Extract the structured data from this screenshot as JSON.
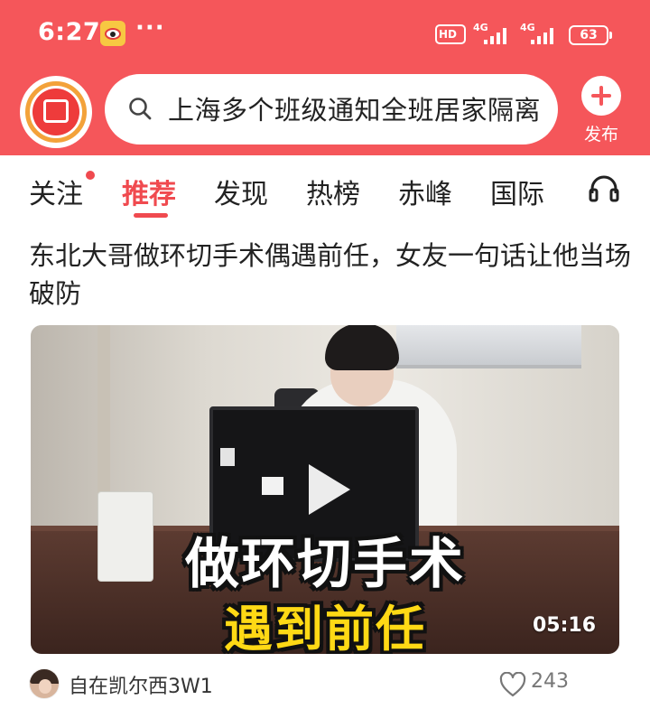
{
  "status_bar": {
    "time": "6:27",
    "more": "···",
    "hd_label": "HD",
    "signal1_label": "4G",
    "signal2_label": "4G",
    "battery": "63"
  },
  "header": {
    "search_query": "上海多个班级通知全班居家隔离",
    "post_label": "发布"
  },
  "tabs": [
    {
      "label": "关注"
    },
    {
      "label": "推荐"
    },
    {
      "label": "发现"
    },
    {
      "label": "热榜"
    },
    {
      "label": "赤峰"
    },
    {
      "label": "国际"
    }
  ],
  "active_tab": "推荐",
  "feed": {
    "item": {
      "title": "东北大哥做环切手术偶遇前任，女友一句话让他当场破防",
      "video": {
        "caption_line1": "做环切手术",
        "caption_line2": "遇到前任",
        "duration": "05:16"
      },
      "author": "自在凯尔西3W1",
      "likes": "243"
    }
  },
  "colors": {
    "brand_red": "#f5565a",
    "accent_red": "#f04a4f",
    "caption_yellow": "#ffd915"
  },
  "icons": [
    "weibo-app-icon",
    "red-envelope-icon",
    "search-icon",
    "plus-icon",
    "headphones-icon",
    "play-icon",
    "heart-icon"
  ]
}
